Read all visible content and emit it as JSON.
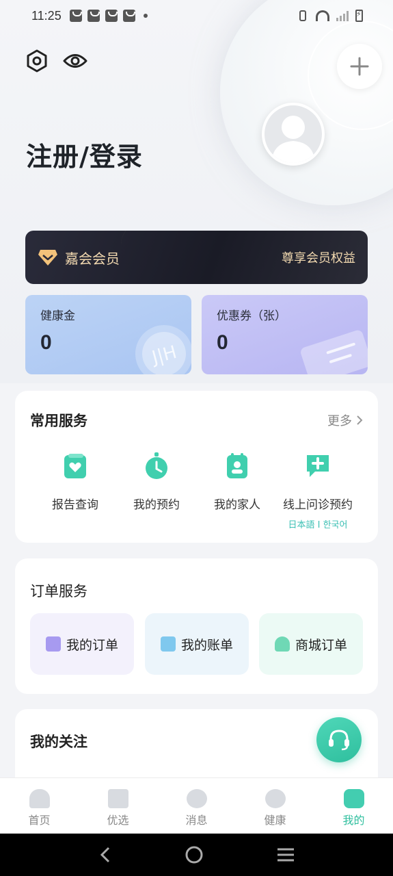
{
  "status_bar": {
    "time": "11:25"
  },
  "header": {
    "login_title": "注册/登录"
  },
  "member": {
    "label": "嘉会会员",
    "link": "尊享会员权益"
  },
  "wallet": {
    "health": {
      "label": "健康金",
      "value": "0"
    },
    "coupon": {
      "label": "优惠券（张）",
      "value": "0"
    }
  },
  "services": {
    "title": "常用服务",
    "more": "更多",
    "items": [
      {
        "label": "报告查询",
        "icon": "report-icon"
      },
      {
        "label": "我的预约",
        "icon": "timer-icon"
      },
      {
        "label": "我的家人",
        "icon": "family-icon"
      },
      {
        "label": "线上问诊预约",
        "icon": "consult-icon",
        "sub": "日本語 I 한국어"
      }
    ]
  },
  "orders": {
    "title": "订单服务",
    "items": [
      {
        "label": "我的订单"
      },
      {
        "label": "我的账单"
      },
      {
        "label": "商城订单"
      }
    ]
  },
  "follow": {
    "title": "我的关注"
  },
  "tabs": [
    {
      "label": "首页"
    },
    {
      "label": "优选"
    },
    {
      "label": "消息"
    },
    {
      "label": "健康"
    },
    {
      "label": "我的"
    }
  ],
  "colors": {
    "accent": "#2fbf9e",
    "member_gold": "#f2d9b0",
    "member_bg": "#1a1b26"
  }
}
